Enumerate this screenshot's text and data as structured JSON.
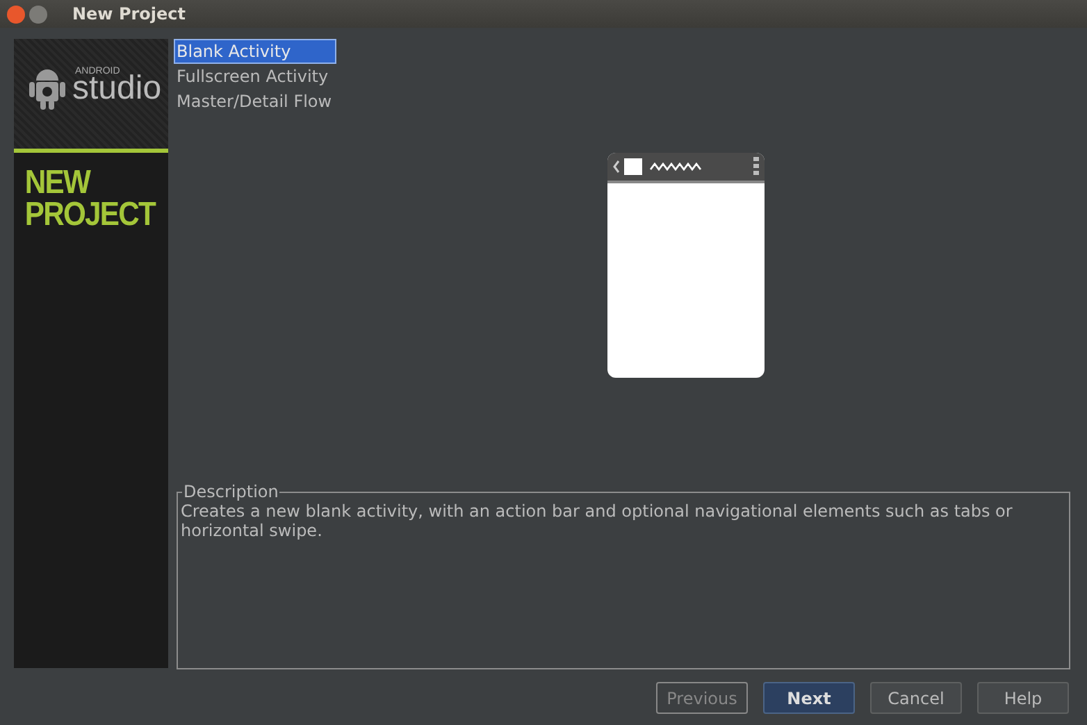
{
  "window": {
    "title": "New Project"
  },
  "banner": {
    "brand_small": "ANDROID",
    "brand": "studio",
    "heading_lines": [
      "NEW",
      "PROJECT"
    ]
  },
  "templates": [
    {
      "label": "Blank Activity",
      "selected": true
    },
    {
      "label": "Fullscreen Activity",
      "selected": false
    },
    {
      "label": "Master/Detail Flow",
      "selected": false
    }
  ],
  "description": {
    "title": "Description",
    "text": "Creates a new blank activity, with an action bar and optional navigational elements such as tabs or horizontal swipe."
  },
  "buttons": [
    {
      "label": "Previous",
      "disabled": true,
      "default": false
    },
    {
      "label": "Next",
      "disabled": false,
      "default": true
    },
    {
      "label": "Cancel",
      "disabled": false,
      "default": false
    },
    {
      "label": "Help",
      "disabled": false,
      "default": false
    }
  ]
}
